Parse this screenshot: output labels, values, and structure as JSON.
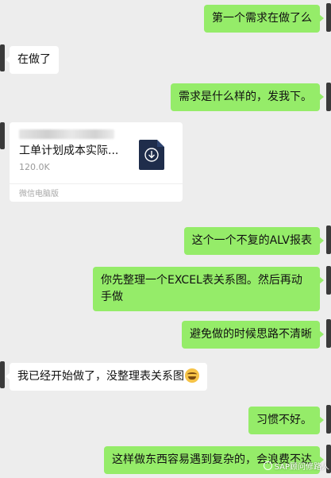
{
  "messages": [
    {
      "from": "me",
      "text": "第一个需求在做了么"
    },
    {
      "from": "other",
      "text": "在做了"
    },
    {
      "from": "me",
      "text": "需求是什么样的，发我下。"
    },
    {
      "from": "other",
      "type": "file",
      "file_name": "工单计划成本实际...",
      "file_size": "120.0K",
      "source": "微信电脑版"
    },
    {
      "from": "me",
      "text": "这个一个不复的ALV报表"
    },
    {
      "from": "me",
      "text": "你先整理一个EXCEL表关系图。然后再动手做"
    },
    {
      "from": "me",
      "text": "避免做的时候思路不清晰"
    },
    {
      "from": "other",
      "text": "我已经开始做了，没整理表关系图"
    },
    {
      "from": "me",
      "text": "习惯不好。"
    },
    {
      "from": "me",
      "text": "这样做东西容易遇到复杂的，会浪费不达"
    }
  ],
  "watermark": "SAP顾问修路人",
  "colors": {
    "me_bubble": "#95ec69",
    "other_bubble": "#ffffff",
    "background": "#ededed"
  },
  "icons": {
    "file": "download-document-icon",
    "emoji": "grinning-sweat-emoji"
  }
}
